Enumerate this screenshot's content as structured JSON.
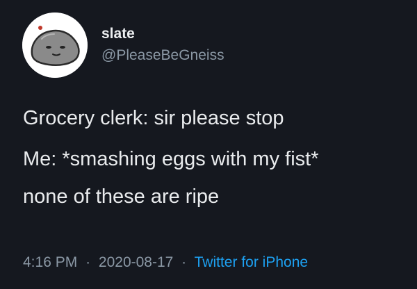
{
  "tweet": {
    "author": {
      "display_name": "slate",
      "handle": "@PleaseBeGneiss",
      "avatar_icon": "rock-avatar-icon"
    },
    "text_lines": [
      "Grocery clerk: sir please stop",
      "Me: *smashing eggs with my fist*",
      "none of these are ripe"
    ],
    "meta": {
      "time": "4:16 PM",
      "separator": "·",
      "date": "2020-08-17",
      "source": "Twitter for iPhone"
    }
  },
  "colors": {
    "background": "#15181f",
    "text": "#e9ebed",
    "secondary_text": "#8b98a5",
    "link": "#1da1f2"
  }
}
